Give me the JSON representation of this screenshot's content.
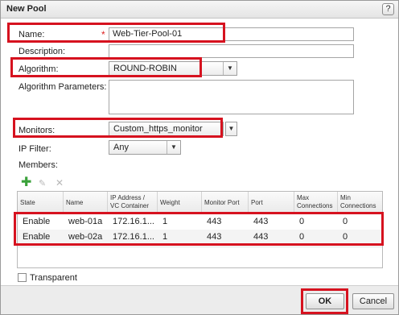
{
  "dialog": {
    "title": "New Pool",
    "help_label": "?"
  },
  "form": {
    "name_label": "Name:",
    "required_mark": "*",
    "name_value": "Web-Tier-Pool-01",
    "description_label": "Description:",
    "description_value": "",
    "algorithm_label": "Algorithm:",
    "algorithm_value": "ROUND-ROBIN",
    "algorithm_params_label": "Algorithm Parameters:",
    "monitors_label": "Monitors:",
    "monitors_value": "Custom_https_monitor",
    "ip_filter_label": "IP Filter:",
    "ip_filter_value": "Any",
    "members_label": "Members:"
  },
  "members_toolbar": {
    "add_icon": "plus-icon",
    "edit_icon": "pencil-icon",
    "delete_icon": "x-icon"
  },
  "members_table": {
    "columns": [
      "State",
      "Name",
      "IP Address / VC Container",
      "Weight",
      "Monitor Port",
      "Port",
      "Max Connections",
      "Min Connections"
    ],
    "rows": [
      [
        "Enable",
        "web-01a",
        "172.16.1...",
        "1",
        "443",
        "443",
        "0",
        "0"
      ],
      [
        "Enable",
        "web-02a",
        "172.16.1...",
        "1",
        "443",
        "443",
        "0",
        "0"
      ]
    ]
  },
  "transparent": {
    "label": "Transparent",
    "checked": false
  },
  "footer": {
    "ok_label": "OK",
    "cancel_label": "Cancel"
  },
  "colors": {
    "highlight": "#d6121f",
    "required": "#dd2222",
    "add_icon": "#3aa13a"
  }
}
